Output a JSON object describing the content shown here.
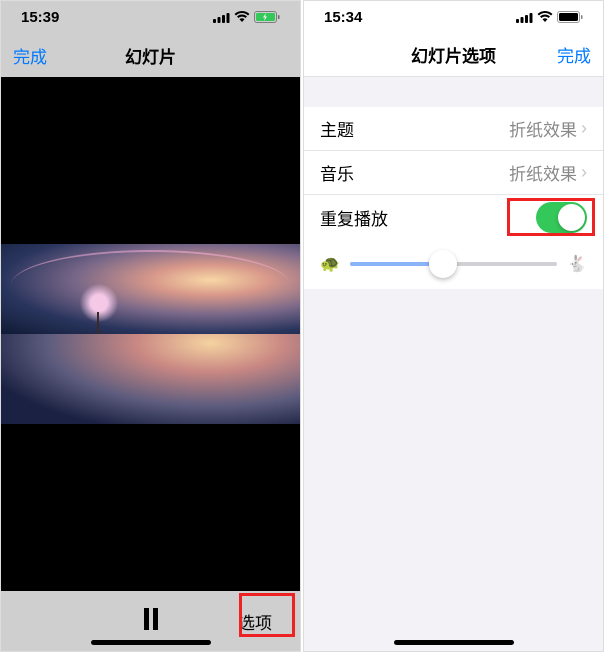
{
  "left": {
    "status_time": "15:39",
    "nav_done": "完成",
    "nav_title": "幻灯片",
    "controls": {
      "options_label": "选项"
    }
  },
  "right": {
    "status_time": "15:34",
    "nav_title": "幻灯片选项",
    "nav_done": "完成",
    "rows": {
      "theme": {
        "label": "主题",
        "value": "折纸效果"
      },
      "music": {
        "label": "音乐",
        "value": "折纸效果"
      },
      "repeat": {
        "label": "重复播放"
      }
    },
    "toggle_on": true,
    "slider_value": 0.45
  }
}
